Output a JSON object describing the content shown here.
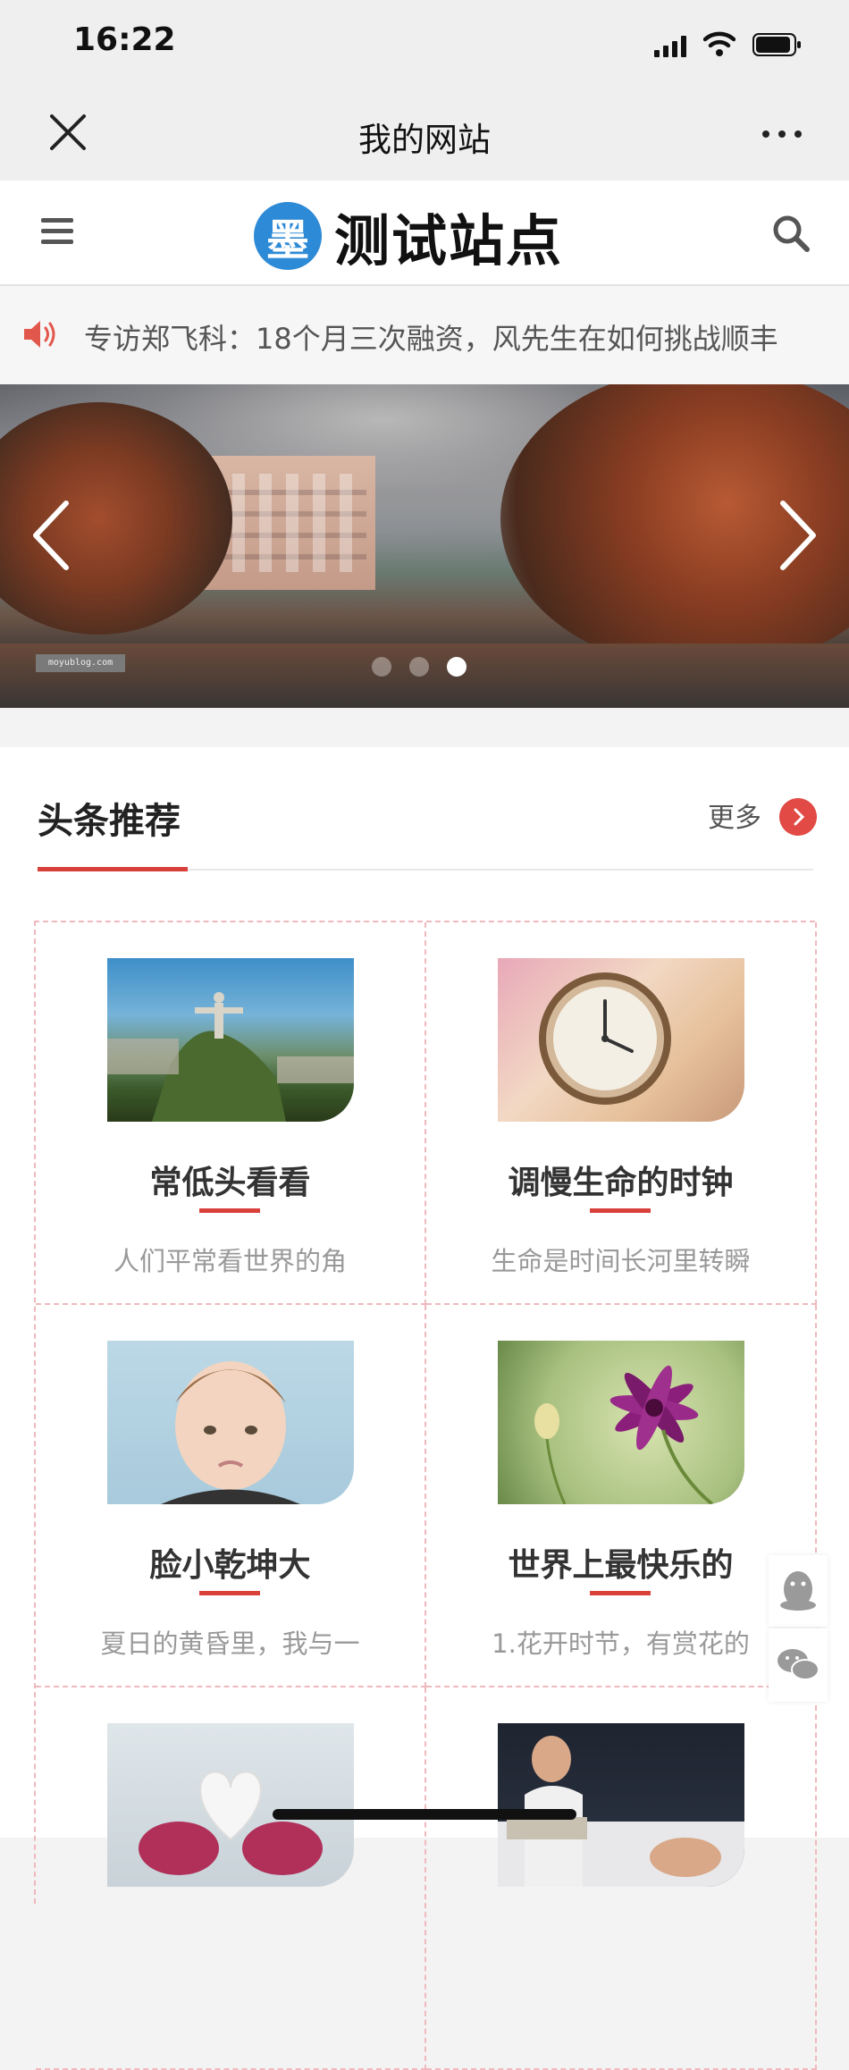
{
  "status_bar": {
    "time": "16:22"
  },
  "title_bar": {
    "title": "我的网站"
  },
  "site_header": {
    "logo_badge": "墨",
    "logo_text": "测试站点"
  },
  "notice": {
    "text": "专访郑飞科：18个月三次融资，风先生在如何挑战顺丰"
  },
  "banner": {
    "watermark": "moyublog.com",
    "slide_count": 3,
    "active_slide": 3
  },
  "section": {
    "title": "头条推荐",
    "more_label": "更多"
  },
  "articles": [
    {
      "title": "常低头看看",
      "desc": "人们平常看世界的角"
    },
    {
      "title": "调慢生命的时钟",
      "desc": "生命是时间长河里转瞬"
    },
    {
      "title": "脸小乾坤大",
      "desc": "夏日的黄昏里，我与一"
    },
    {
      "title": "世界上最快乐的",
      "desc": "1.花开时节，有赏花的"
    },
    {
      "title": "",
      "desc": ""
    },
    {
      "title": "",
      "desc": ""
    }
  ],
  "colors": {
    "accent": "#d9403a",
    "logo_blue": "#2d8ad6",
    "dashed_border": "#f0b9bd"
  },
  "icons": [
    "close-icon",
    "more-dots-icon",
    "menu-icon",
    "search-icon",
    "speaker-icon",
    "chevron-left-icon",
    "chevron-right-icon",
    "chevron-right-circle-icon",
    "qq-icon",
    "wechat-icon"
  ]
}
